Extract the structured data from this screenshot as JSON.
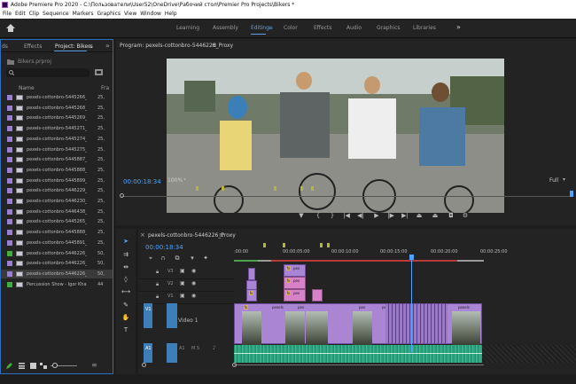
{
  "window": {
    "title": "Adobe Premiere Pro 2020 - C:\\Пользователи\\User52\\OneDrive\\Рабочий стол\\Premier Pro Projects\\Bikers *"
  },
  "menu": [
    "File",
    "Edit",
    "Clip",
    "Sequence",
    "Markers",
    "Graphics",
    "View",
    "Window",
    "Help"
  ],
  "workspaces": [
    "Learning",
    "Assembly",
    "Editing",
    "Color",
    "Effects",
    "Audio",
    "Graphics",
    "Libraries"
  ],
  "workspace_active": "Editing",
  "workspace_more": "»",
  "project_panel": {
    "tabs": [
      "ds",
      "Effects",
      "Project: Bikers",
      "≡"
    ],
    "more": "»",
    "project_file": "Bikers.prproj",
    "col_name": "Name",
    "col_fps": "Fra",
    "items": [
      {
        "name": "pexels-cottonbro-5445266_...",
        "fps": "25,",
        "color": "#9b7ed6"
      },
      {
        "name": "pexels-cottonbro-5445268_...",
        "fps": "25,",
        "color": "#9b7ed6"
      },
      {
        "name": "pexels-cottonbro-5445269_...",
        "fps": "25,",
        "color": "#9b7ed6"
      },
      {
        "name": "pexels-cottonbro-5445271_...",
        "fps": "25,",
        "color": "#9b7ed6"
      },
      {
        "name": "pexels-cottonbro-5445274_...",
        "fps": "25,",
        "color": "#9b7ed6"
      },
      {
        "name": "pexels-cottonbro-5445275_...",
        "fps": "25,",
        "color": "#9b7ed6"
      },
      {
        "name": "pexels-cottonbro-5445887_...",
        "fps": "25,",
        "color": "#9b7ed6"
      },
      {
        "name": "pexels-cottonbro-5445888_...",
        "fps": "25,",
        "color": "#9b7ed6"
      },
      {
        "name": "pexels-cottonbro-5445899_...",
        "fps": "25,",
        "color": "#9b7ed6"
      },
      {
        "name": "pexels-cottonbro-5446229_...",
        "fps": "25,",
        "color": "#9b7ed6"
      },
      {
        "name": "pexels-cottonbro-5446230_...",
        "fps": "25,",
        "color": "#9b7ed6"
      },
      {
        "name": "pexels-cottonbro-5446438_...",
        "fps": "25,",
        "color": "#9b7ed6"
      },
      {
        "name": "pexels-cottonbro-5445265_...",
        "fps": "25,",
        "color": "#9b7ed6"
      },
      {
        "name": "pexels-cottonbro-5445888_...",
        "fps": "25,",
        "color": "#9b7ed6"
      },
      {
        "name": "pexels-cottonbro-5445891_...",
        "fps": "25,",
        "color": "#9b7ed6"
      },
      {
        "name": "pexels-cottonbro-5446226_...",
        "fps": "50,",
        "color": "#3fae3a"
      },
      {
        "name": "pexels-cottonbro-5446226_...",
        "fps": "50,",
        "color": "#9b7ed6"
      },
      {
        "name": "pexels-cottonbro-5446226_...",
        "fps": "50,",
        "color": "#9b7ed6"
      },
      {
        "name": "Percussion Show - Igor Khai...",
        "fps": "44",
        "color": "#3fae3a"
      }
    ]
  },
  "program_monitor": {
    "title": "Program: pexels-cottonbro-5446226_Proxy",
    "menu_icon": "≡",
    "timecode": "00:00:18:34",
    "zoom": "100%",
    "resolution": "Full",
    "controls": [
      "marker-icon",
      "in-point-icon",
      "out-point-icon",
      "go-to-in-icon",
      "step-back-icon",
      "play-icon",
      "step-forward-icon",
      "go-to-out-icon",
      "lift-icon",
      "extract-icon",
      "export-frame-icon",
      "settings-icon"
    ]
  },
  "timeline": {
    "sequence_tab": "pexels-cottonbro-5446226_Proxy",
    "close": "×",
    "menu_icon": "≡",
    "timecode": "00:00:18:34",
    "ruler": [
      ":00:00",
      "00:00:05:00",
      "00:00:10:00",
      "00:00:15:00",
      "00:00:20:00",
      "00:00:25:00"
    ],
    "playhead_fraction": 0.715,
    "video_tracks": [
      "V3",
      "V2",
      "V1"
    ],
    "audio_tracks": [
      "A1"
    ],
    "v1_label": "Video 1",
    "source_v": "V1",
    "source_a": "A1",
    "audio_mix": "M S",
    "clip_label_short": "pex",
    "clip_label_long": "pexels",
    "fx_label": "fx"
  },
  "colors": {
    "accent": "#4da3ff",
    "clip_purple": "#a985d4",
    "clip_pink": "#d781c9",
    "audio": "#2fae86"
  }
}
